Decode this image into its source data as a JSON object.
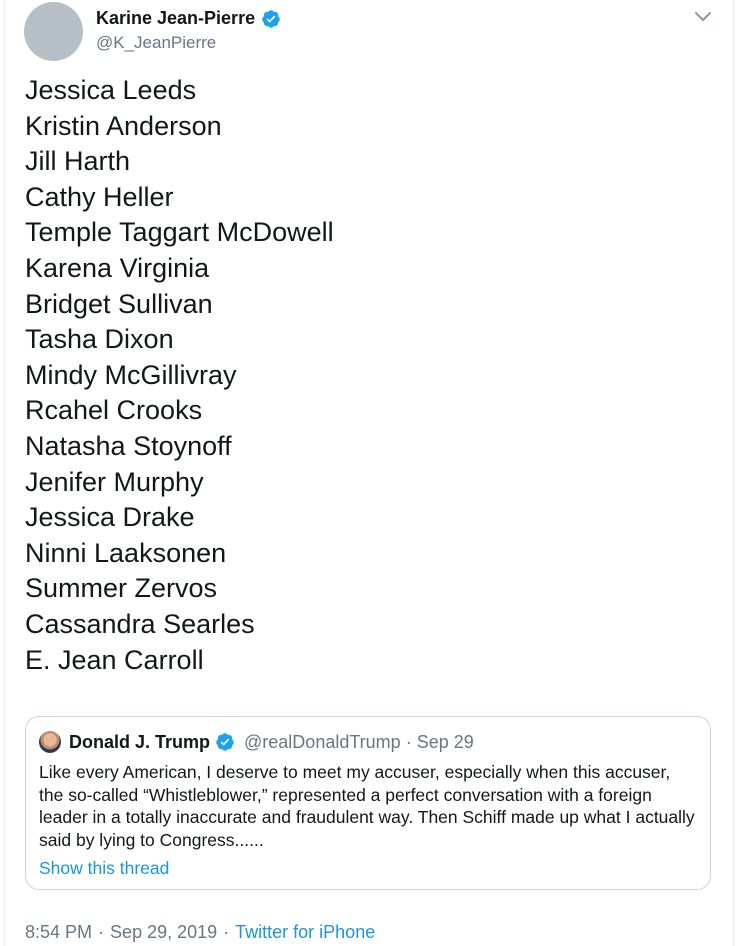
{
  "tweet": {
    "author": {
      "display_name": "Karine Jean-Pierre",
      "handle": "@K_JeanPierre",
      "verified": true,
      "avatar_color": "#b6bec6"
    },
    "names": [
      "Jessica Leeds",
      "Kristin Anderson",
      "Jill Harth",
      "Cathy Heller",
      "Temple Taggart McDowell",
      "Karena Virginia",
      "Bridget Sullivan",
      "Tasha Dixon",
      "Mindy McGillivray",
      "Rcahel Crooks",
      "Natasha Stoynoff",
      "Jenifer Murphy",
      "Jessica Drake",
      "Ninni Laaksonen",
      "Summer Zervos",
      "Cassandra Searles",
      "E. Jean Carroll"
    ],
    "quoted": {
      "display_name": "Donald J. Trump",
      "handle": "@realDonaldTrump",
      "separator": "·",
      "date": "Sep 29",
      "verified": true,
      "text": "Like every American, I deserve to meet my accuser, especially when this accuser, the so-called “Whistleblower,” represented a perfect conversation with a foreign leader in a totally inaccurate and fraudulent way. Then Schiff made up what I actually said by lying to Congress......",
      "show_thread_label": "Show this thread"
    },
    "footer": {
      "time": "8:54 PM",
      "separator": "·",
      "date": "Sep 29, 2019",
      "source": "Twitter for iPhone"
    }
  },
  "icons": {
    "verified": "verified-badge-icon",
    "caret": "chevron-down-icon"
  },
  "colors": {
    "link": "#1b95e0",
    "verified": "#1da1f2",
    "muted": "#657786",
    "text": "#14171a",
    "border": "#ccd6dd"
  }
}
